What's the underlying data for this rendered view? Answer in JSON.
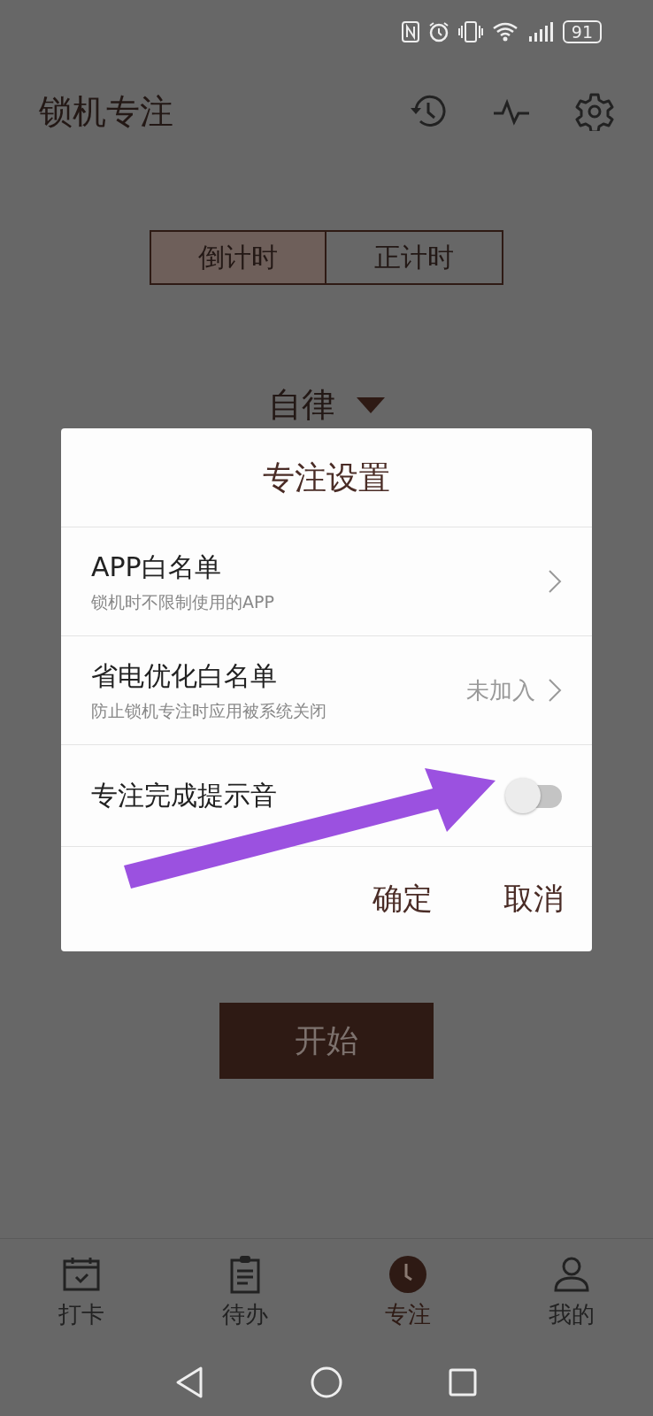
{
  "status_bar": {
    "battery": "91"
  },
  "app_bar": {
    "title": "锁机专注"
  },
  "mode_tabs": [
    {
      "label": "倒计时",
      "selected": true
    },
    {
      "label": "正计时",
      "selected": false
    }
  ],
  "category_dropdown": {
    "value": "自律"
  },
  "start_button": {
    "label": "开始"
  },
  "dialog": {
    "title": "专注设置",
    "rows": [
      {
        "kind": "link",
        "title": "APP白名单",
        "subtitle": "锁机时不限制使用的APP"
      },
      {
        "kind": "link",
        "title": "省电优化白名单",
        "subtitle": "防止锁机专注时应用被系统关闭",
        "value": "未加入"
      },
      {
        "kind": "toggle",
        "title": "专注完成提示音",
        "on": false
      }
    ],
    "buttons": [
      "确定",
      "取消"
    ]
  },
  "bottom_nav": [
    {
      "label": "打卡",
      "selected": false
    },
    {
      "label": "待办",
      "selected": false
    },
    {
      "label": "专注",
      "selected": true
    },
    {
      "label": "我的",
      "selected": false
    }
  ]
}
